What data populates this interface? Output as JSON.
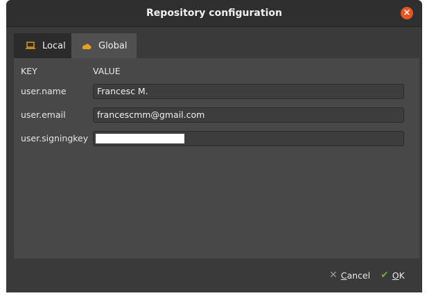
{
  "window": {
    "title": "Repository configuration",
    "close_icon": "close-icon"
  },
  "tabs": [
    {
      "label": "Local",
      "icon": "laptop-icon",
      "active": false
    },
    {
      "label": "Global",
      "icon": "cloud-icon",
      "active": true
    }
  ],
  "table": {
    "headers": {
      "key": "KEY",
      "value": "VALUE"
    },
    "rows": [
      {
        "key": "user.name",
        "value": "Francesc M."
      },
      {
        "key": "user.email",
        "value": "francescmm@gmail.com"
      },
      {
        "key": "user.signingkey",
        "value": ""
      }
    ]
  },
  "footer": {
    "cancel_label": "Cancel",
    "ok_label": "OK",
    "cancel_icon": "x-icon",
    "ok_icon": "checkmark-icon"
  },
  "colors": {
    "accent": "#e95420",
    "icon_orange": "#e8a020",
    "check_green": "#73a843"
  }
}
